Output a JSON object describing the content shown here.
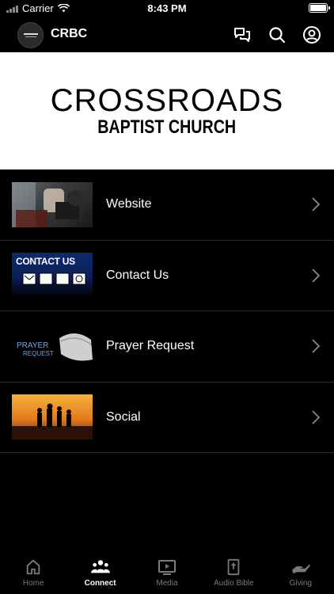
{
  "status_bar": {
    "carrier": "Carrier",
    "time": "8:43 PM"
  },
  "nav": {
    "title": "CRBC",
    "icons": [
      "chat-icon",
      "search-icon",
      "profile-icon"
    ]
  },
  "banner": {
    "line1": "CROSSROADS",
    "line2": "BAPTIST CHURCH"
  },
  "list": {
    "items": [
      {
        "label": "Website",
        "thumb": "website-thumbnail"
      },
      {
        "label": "Contact Us",
        "thumb": "contact-us-thumbnail",
        "thumb_text": "CONTACT US"
      },
      {
        "label": "Prayer Request",
        "thumb": "prayer-request-thumbnail",
        "thumb_text_1": "PRAYER",
        "thumb_text_2": "REQUEST"
      },
      {
        "label": "Social",
        "thumb": "social-thumbnail"
      }
    ]
  },
  "tabs": [
    {
      "label": "Home",
      "icon": "home-icon",
      "active": false
    },
    {
      "label": "Connect",
      "icon": "people-icon",
      "active": true
    },
    {
      "label": "Media",
      "icon": "play-icon",
      "active": false
    },
    {
      "label": "Audio Bible",
      "icon": "bible-icon",
      "active": false
    },
    {
      "label": "Giving",
      "icon": "giving-icon",
      "active": false
    }
  ],
  "colors": {
    "background": "#000000",
    "active_tab": "#ffffff",
    "inactive_tab": "#7a7a7a"
  }
}
